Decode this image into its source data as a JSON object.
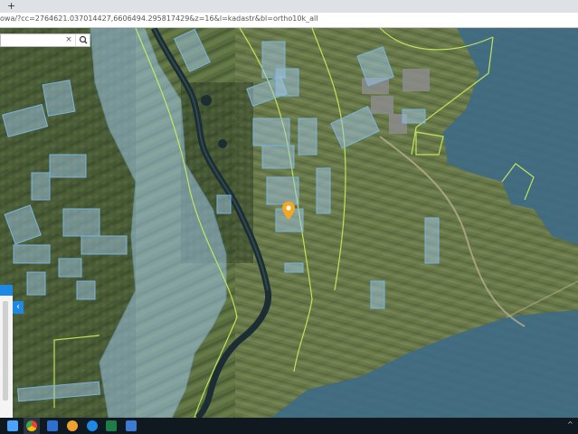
{
  "browser": {
    "new_tab_symbol": "+",
    "url": "owa/?cc=2764621.037014427,6606494.295817429&z=16&l=kadastr&bl=ortho10k_all"
  },
  "map_search": {
    "query": "",
    "clear_symbol": "×",
    "search_icon": "magnifier-icon"
  },
  "side_panel": {
    "collapse_symbol": "‹"
  },
  "taskbar": {
    "icons": [
      "windows-start-icon",
      "chrome-icon",
      "explorer-icon",
      "chrome-canary-icon",
      "edge-icon",
      "excel-icon",
      "outlook-icon"
    ]
  },
  "colors": {
    "parcel_fill": "#9fc6e6",
    "parcel_border": "#7bb4dc",
    "boundary_line": "#c8f05a",
    "river": "#1c2e33",
    "forest": "#3e6a86",
    "marker": "#f5a623",
    "accent": "#1e88e5"
  }
}
